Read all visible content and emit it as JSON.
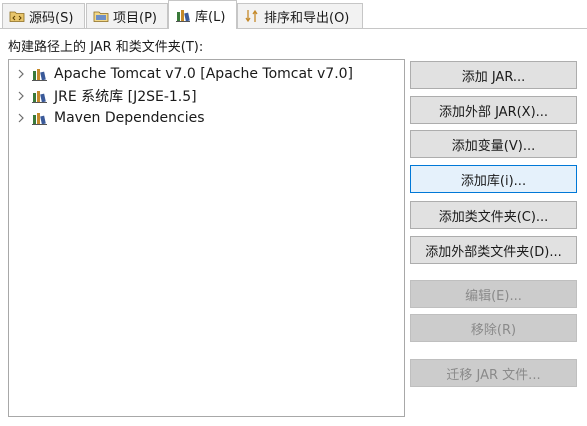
{
  "tabs": [
    {
      "label": "源码(S)",
      "icon": "source-folder-icon",
      "active": false
    },
    {
      "label": "项目(P)",
      "icon": "project-folder-icon",
      "active": false
    },
    {
      "label": "库(L)",
      "icon": "library-icon",
      "active": true
    },
    {
      "label": "排序和导出(O)",
      "icon": "order-export-icon",
      "active": false
    }
  ],
  "section_label": "构建路径上的 JAR 和类文件夹(T):",
  "tree": [
    {
      "label": "Apache Tomcat v7.0 [Apache Tomcat v7.0]",
      "icon": "library-icon"
    },
    {
      "label": "JRE 系统库 [J2SE-1.5]",
      "icon": "library-icon"
    },
    {
      "label": "Maven Dependencies",
      "icon": "library-icon"
    }
  ],
  "buttons": {
    "add_jar": "添加 JAR...",
    "add_external_jar": "添加外部 JAR(X)...",
    "add_variable": "添加变量(V)...",
    "add_library": "添加库(i)...",
    "add_class_folder": "添加类文件夹(C)...",
    "add_external_class_folder": "添加外部类文件夹(D)...",
    "edit": "编辑(E)...",
    "remove": "移除(R)",
    "migrate_jar": "迁移 JAR 文件..."
  },
  "colors": {
    "focus_border": "#0078d7",
    "disabled_text": "#8a8a8a"
  }
}
